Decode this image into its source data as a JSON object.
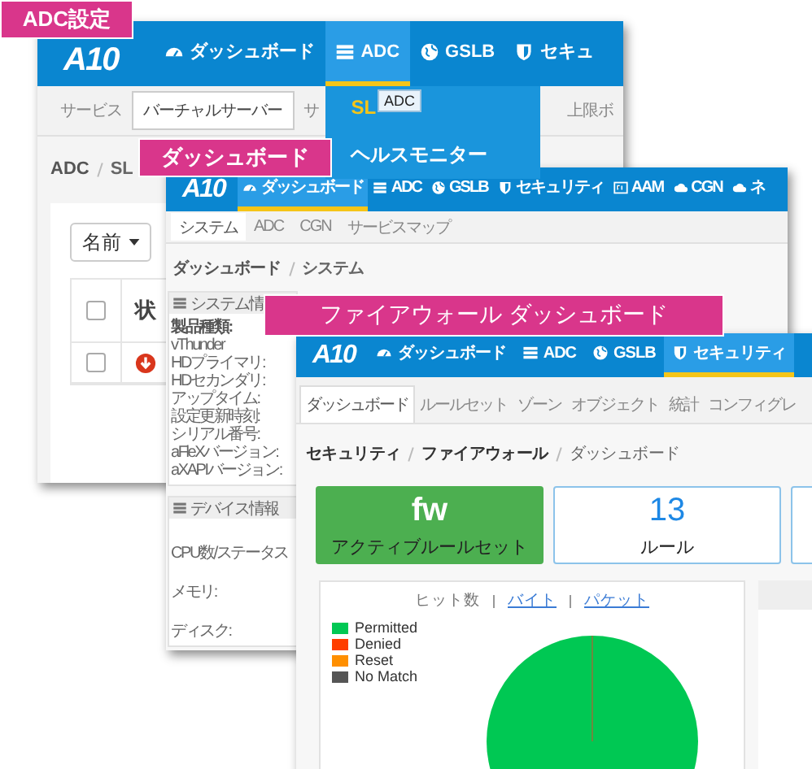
{
  "callouts": [
    {
      "text": "ADC設定"
    },
    {
      "text": "ダッシュボード"
    },
    {
      "text": "ファイアウォール ダッシュボード"
    }
  ],
  "adc_window": {
    "logo": "A10",
    "nav": [
      {
        "label": "ダッシュボード",
        "selected": false
      },
      {
        "label": "ADC",
        "selected": true
      },
      {
        "label": "GSLB",
        "selected": false
      },
      {
        "label": "セキュ",
        "selected": false
      }
    ],
    "subnav": [
      {
        "label": "サービス",
        "selected": false
      },
      {
        "label": "バーチャルサーバー",
        "selected": true
      },
      {
        "label": "サ",
        "selected": false
      },
      {
        "label": "上限ボ",
        "selected": false
      }
    ],
    "menu": [
      {
        "label": "SL",
        "selected": true
      },
      {
        "label": "ヘルスモニター",
        "selected": false
      }
    ],
    "tooltip": "ADC",
    "breadcrumb": [
      "ADC",
      "SL"
    ],
    "sort_button": "名前",
    "table": {
      "header_checked": false,
      "columns": [
        "状"
      ],
      "rows": [
        {
          "checked": false
        }
      ]
    }
  },
  "system_window": {
    "logo": "A10",
    "nav": [
      {
        "label": "ダッシュボード",
        "selected": true
      },
      {
        "label": "ADC",
        "selected": false
      },
      {
        "label": "GSLB",
        "selected": false
      },
      {
        "label": "セキュリティ",
        "selected": false
      },
      {
        "label": "AAM",
        "selected": false
      },
      {
        "label": "CGN",
        "selected": false
      },
      {
        "label": "ネ",
        "selected": false
      }
    ],
    "subnav": [
      {
        "label": "システム",
        "selected": true
      },
      {
        "label": "ADC",
        "selected": false
      },
      {
        "label": "CGN",
        "selected": false
      },
      {
        "label": "サービスマップ",
        "selected": false
      }
    ],
    "breadcrumb": [
      "ダッシュボード",
      "システム"
    ],
    "panels": [
      {
        "title": "システム情",
        "fields": [
          {
            "text": "製品種類:",
            "kind": "heading"
          },
          {
            "text": "vThunder",
            "kind": "value"
          },
          {
            "text": "HDプライマリ:",
            "kind": "value"
          },
          {
            "text": "HDセカンダリ:",
            "kind": "value"
          },
          {
            "text": "アップタイム:",
            "kind": "value"
          },
          {
            "text": "設定更新時刻:",
            "kind": "value"
          },
          {
            "text": "シリアル番号:",
            "kind": "value"
          },
          {
            "text": "aFleXバージョン:",
            "kind": "value"
          },
          {
            "text": "aXAPIバージョン:",
            "kind": "value"
          }
        ]
      },
      {
        "title": "デバイス情報",
        "fields": [
          {
            "text": "CPU数/ステータス",
            "kind": "row"
          },
          {
            "text": "メモリ:",
            "kind": "row"
          },
          {
            "text": "ディスク:",
            "kind": "row"
          }
        ]
      }
    ]
  },
  "firewall_window": {
    "logo": "A10",
    "nav": [
      {
        "label": "ダッシュボード",
        "selected": false
      },
      {
        "label": "ADC",
        "selected": false
      },
      {
        "label": "GSLB",
        "selected": false
      },
      {
        "label": "セキュリティ",
        "selected": true
      }
    ],
    "subnav": [
      {
        "label": "ダッシュボード",
        "selected": true
      },
      {
        "label": "ルールセット",
        "selected": false
      },
      {
        "label": "ゾーン",
        "selected": false
      },
      {
        "label": "オブジェクト",
        "selected": false
      },
      {
        "label": "統計",
        "selected": false
      },
      {
        "label": "コンフィグレ",
        "selected": false
      }
    ],
    "breadcrumb": [
      "セキュリティ",
      "ファイアウォール",
      "ダッシュボード"
    ],
    "cards": [
      {
        "kind": "filled",
        "value": "fw",
        "label": "アクティブルールセット"
      },
      {
        "kind": "outline",
        "value": "13",
        "label": "ルール"
      },
      {
        "kind": "outline"
      }
    ],
    "chart": {
      "metrics": [
        {
          "label": "ヒット数",
          "selected": true
        },
        {
          "label": "バイト",
          "selected": false
        },
        {
          "label": "パケット",
          "selected": false
        }
      ],
      "legend": [
        {
          "label": "Permitted",
          "color": "#00c853"
        },
        {
          "label": "Denied",
          "color": "#ff3d00"
        },
        {
          "label": "Reset",
          "color": "#ff8f00"
        },
        {
          "label": "No Match",
          "color": "#555555"
        }
      ]
    }
  }
}
